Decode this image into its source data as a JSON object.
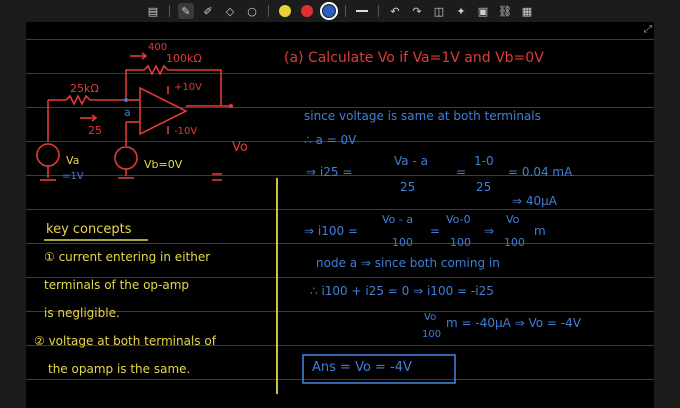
{
  "toolbar": {
    "icons": [
      "sidebar-icon",
      "pen-icon",
      "highlighter-icon",
      "eraser-icon",
      "lasso-icon",
      "undo-icon",
      "redo-icon",
      "shape-icon",
      "sticker-icon",
      "image-icon",
      "link-icon",
      "text-box-icon"
    ],
    "colors": [
      "#e8d23a",
      "#e0312f",
      "#2b5fbf"
    ],
    "selected_color": "#2b5fbf"
  },
  "question": {
    "text": "(a) Calculate Vo if Va=1V and Vb=0V"
  },
  "circuit": {
    "r_feedback_value": "100kΩ",
    "r_feedback_current": "400",
    "r_input_value": "25kΩ",
    "r_input_current": "25",
    "node_label": "a",
    "supply_pos": "+10V",
    "supply_neg": "-10V",
    "va_label": "Va",
    "va_value": "=1V",
    "vb_label": "Vb=0V",
    "vo_label": "Vo"
  },
  "solution": {
    "line1": "since voltage is same at both terminals",
    "line2": "∴ a = 0V",
    "i25_label": "⇒ i25 =",
    "i25_frac1_num": "Va - a",
    "i25_frac1_den": "25",
    "i25_frac2_num": "1-0",
    "i25_frac2_den": "25",
    "i25_result": "= 0.04 mA",
    "i25_boxed": "⇒ 40μA",
    "i100_label": "⇒ i100 =",
    "i100_frac1_num": "Vo - a",
    "i100_frac1_den": "100",
    "i100_frac2_num": "Vo-0",
    "i100_frac2_den": "100",
    "i100_frac3_num": "Vo",
    "i100_frac3_den": "100",
    "i100_unit": "m",
    "node_line": "node a ⇒ since both coming in",
    "kcl_line": "∴ i100 + i25 = 0 ⇒ i100 = -i25",
    "final_frac_num": "Vo",
    "final_frac_den": "100",
    "final_line": "m = -40μA ⇒ Vo = -4V",
    "answer": "Ans = Vo = -4V"
  },
  "key_concepts": {
    "title": "key concepts",
    "point1_line1": "① current entering in either",
    "point1_line2": "terminals of the op-amp",
    "point1_line3": "is negligible.",
    "point2_line1": "② voltage at both terminals of",
    "point2_line2": "the opamp is the same."
  }
}
